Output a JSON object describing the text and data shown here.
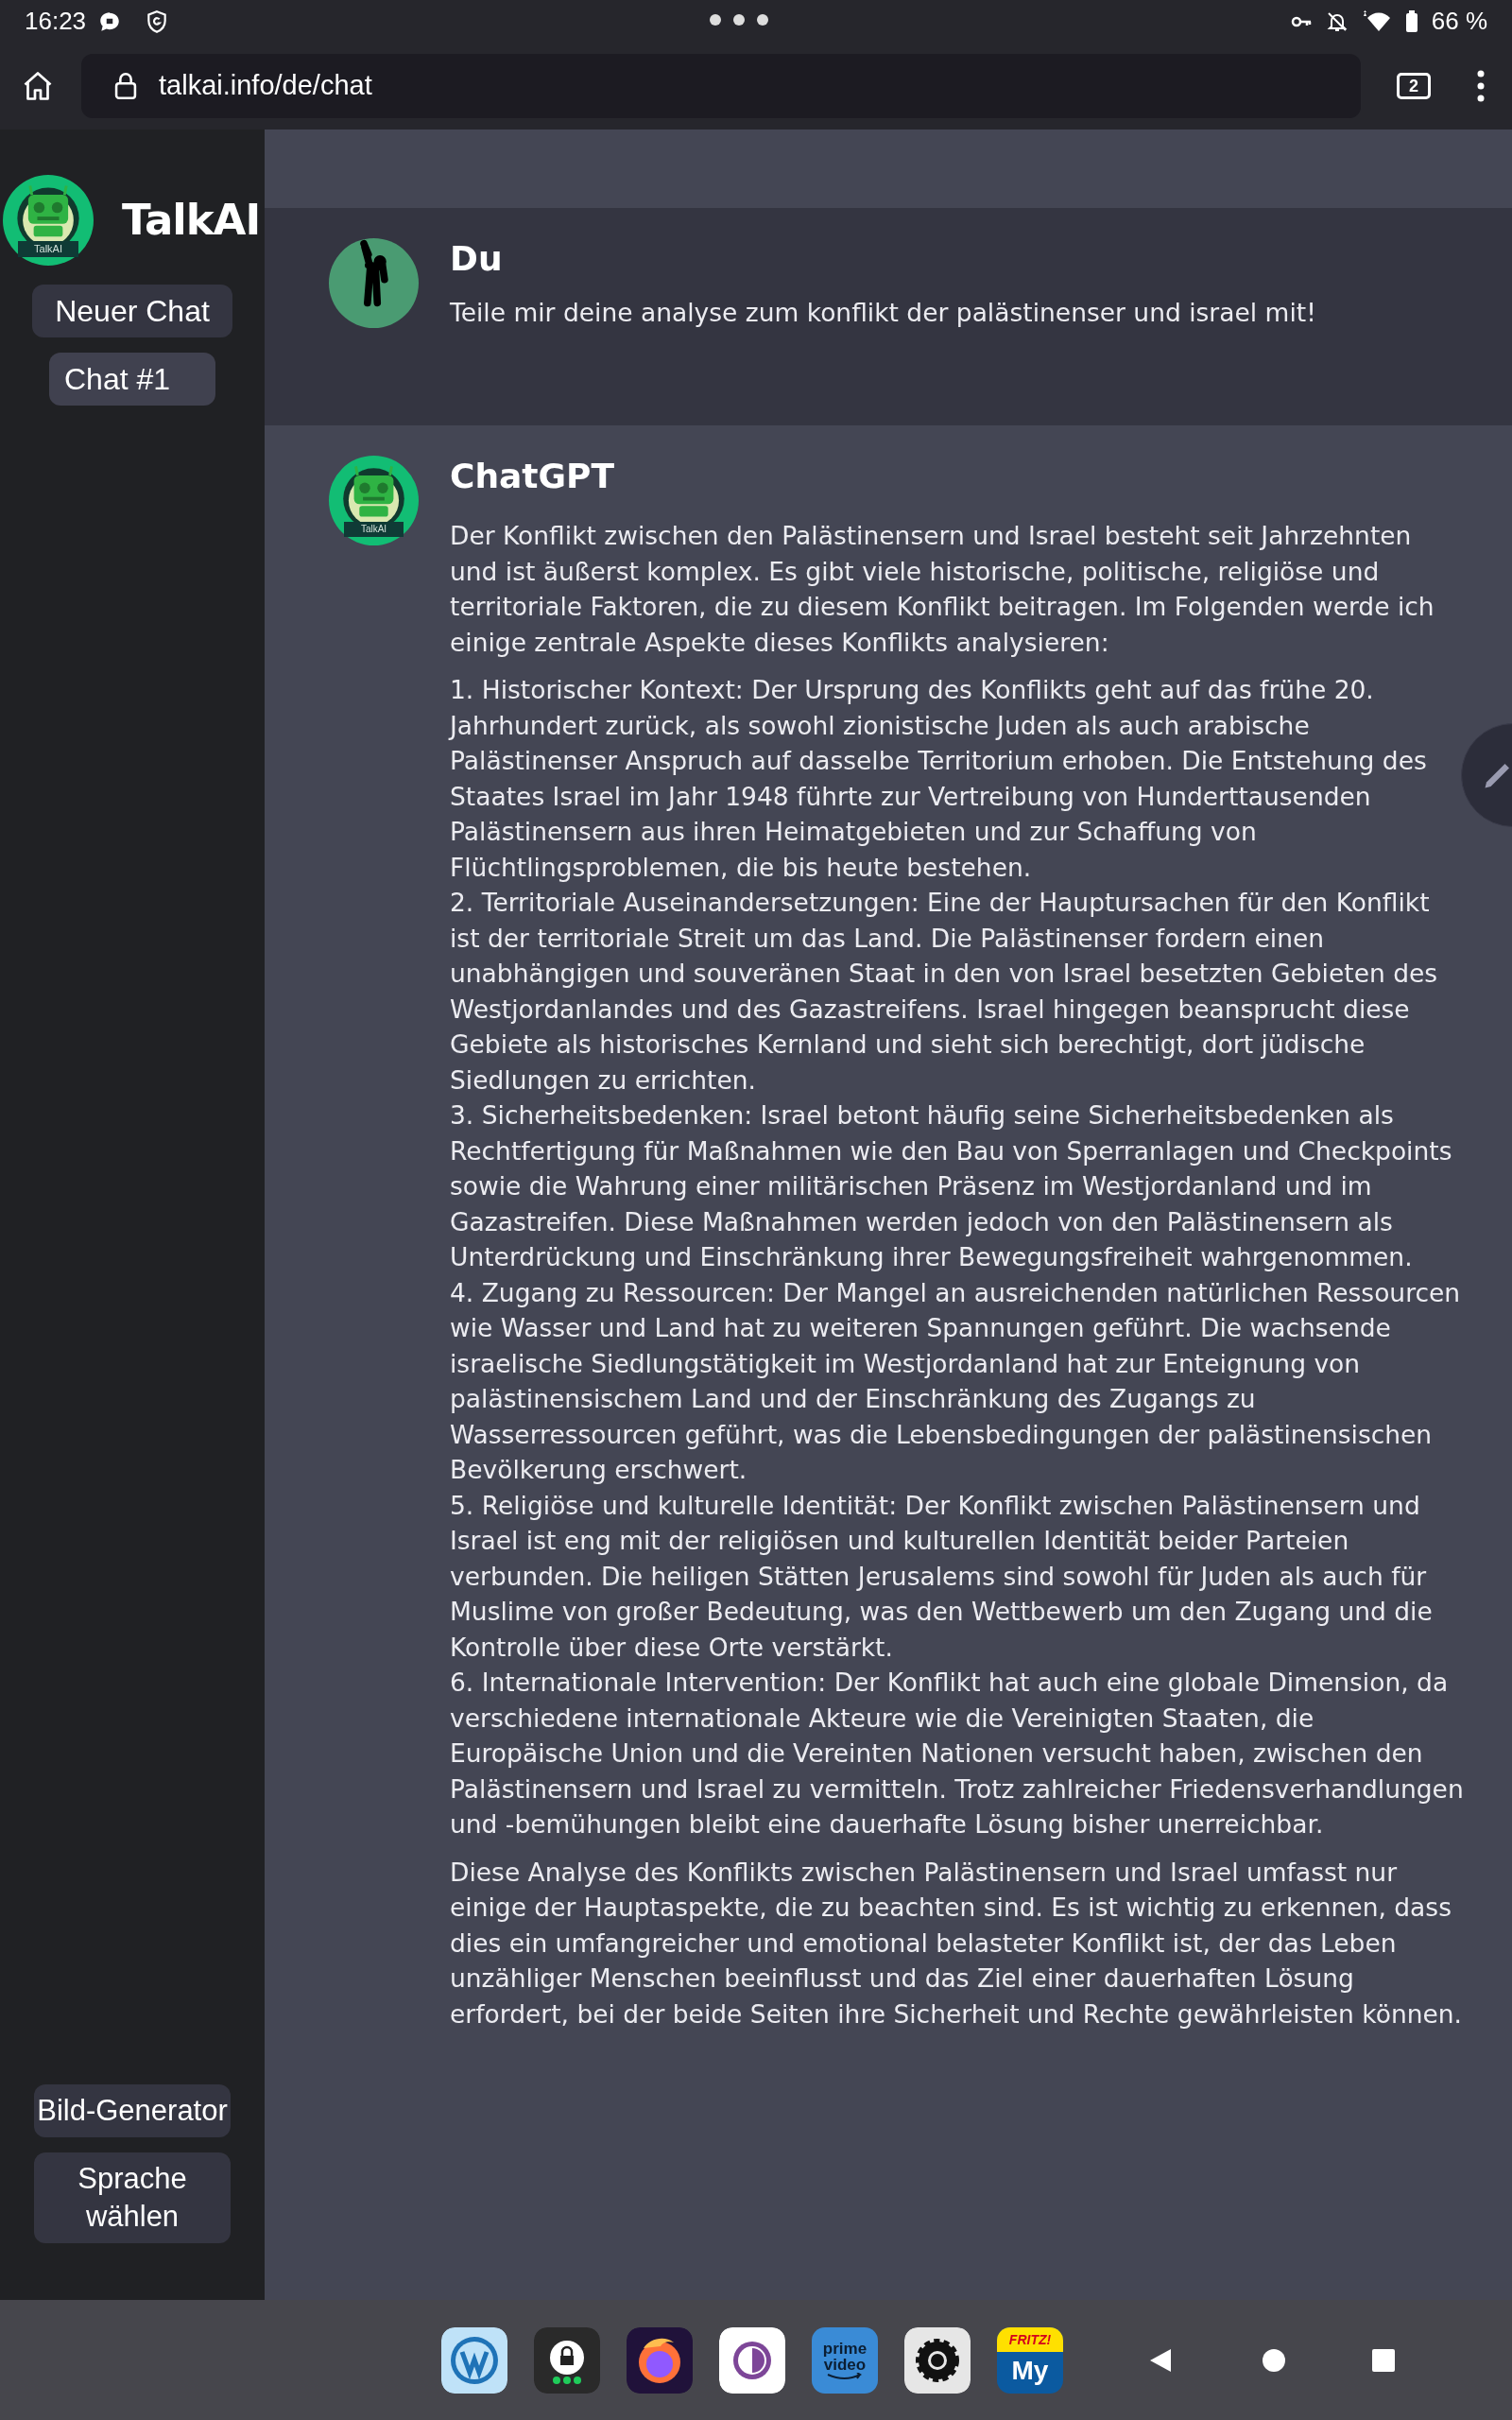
{
  "status_bar": {
    "time": "16:23",
    "battery": "66 %"
  },
  "browser": {
    "url": "talkai.info/de/chat",
    "tab_count": "2"
  },
  "sidebar": {
    "brand": "TalkAI",
    "logo_badge": "TalkAI",
    "top_buttons": [
      {
        "label": "Neuer Chat",
        "selected": false
      },
      {
        "label": "Chat #1",
        "selected": true
      }
    ],
    "bottom_buttons": [
      "Bild-Generator",
      "Sprache wählen"
    ]
  },
  "messages": [
    {
      "kind": "user",
      "author": "Du",
      "blocks": [
        {
          "kind": "paragraph",
          "text": "Teile mir deine analyse zum konflikt der palästinenser und israel mit!"
        }
      ]
    },
    {
      "kind": "assistant",
      "author": "ChatGPT",
      "avatar_badge": "TalkAI",
      "blocks": [
        {
          "kind": "paragraph",
          "text": "Der Konflikt zwischen den Palästinensern und Israel besteht seit Jahrzehnten und ist äußerst komplex. Es gibt viele historische, politische, religiöse und territoriale Faktoren, die zu diesem Konflikt beitragen. Im Folgenden werde ich einige zentrale Aspekte dieses Konflikts analysieren:"
        },
        {
          "kind": "list",
          "items": [
            "1. Historischer Kontext: Der Ursprung des Konflikts geht auf das frühe 20. Jahrhundert zurück, als sowohl zionistische Juden als auch arabische Palästinenser Anspruch auf dasselbe Territorium erhoben. Die Entstehung des Staates Israel im Jahr 1948 führte zur Vertreibung von Hunderttausenden Palästinensern aus ihren Heimatgebieten und zur Schaffung von Flüchtlingsproblemen, die bis heute bestehen.",
            "2. Territoriale Auseinandersetzungen: Eine der Hauptursachen für den Konflikt ist der territoriale Streit um das Land. Die Palästinenser fordern einen unabhängigen und souveränen Staat in den von Israel besetzten Gebieten des Westjordanlandes und des Gazastreifens. Israel hingegen beansprucht diese Gebiete als historisches Kernland und sieht sich berechtigt, dort jüdische Siedlungen zu errichten.",
            "3. Sicherheitsbedenken: Israel betont häufig seine Sicherheitsbedenken als Rechtfertigung für Maßnahmen wie den Bau von Sperranlagen und Checkpoints sowie die Wahrung einer militärischen Präsenz im Westjordanland und im Gazastreifen. Diese Maßnahmen werden jedoch von den Palästinensern als Unterdrückung und Einschränkung ihrer Bewegungsfreiheit wahrgenommen.",
            "4. Zugang zu Ressourcen: Der Mangel an ausreichenden natürlichen Ressourcen wie Wasser und Land hat zu weiteren Spannungen geführt. Die wachsende israelische Siedlungstätigkeit im Westjordanland hat zur Enteignung von palästinensischem Land und der Einschränkung des Zugangs zu Wasserressourcen geführt, was die Lebensbedingungen der palästinensischen Bevölkerung erschwert.",
            "5. Religiöse und kulturelle Identität: Der Konflikt zwischen Palästinensern und Israel ist eng mit der religiösen und kulturellen Identität beider Parteien verbunden. Die heiligen Stätten Jerusalems sind sowohl für Juden als auch für Muslime von großer Bedeutung, was den Wettbewerb um den Zugang und die Kontrolle über diese Orte verstärkt.",
            "6. Internationale Intervention: Der Konflikt hat auch eine globale Dimension, da verschiedene internationale Akteure wie die Vereinigten Staaten, die Europäische Union und die Vereinten Nationen versucht haben, zwischen den Palästinensern und Israel zu vermitteln. Trotz zahlreicher Friedensverhandlungen und -bemühungen bleibt eine dauerhafte Lösung bisher unerreichbar."
          ]
        },
        {
          "kind": "paragraph",
          "text": "Diese Analyse des Konflikts zwischen Palästinensern und Israel umfasst nur einige der Hauptaspekte, die zu beachten sind. Es ist wichtig zu erkennen, dass dies ein umfangreicher und emotional belasteter Konflikt ist, der das Leben unzähliger Menschen beeinflusst und das Ziel einer dauerhaften Lösung erfordert, bei der beide Seiten ihre Sicherheit und Rechte gewährleisten können."
        }
      ]
    }
  ],
  "dock": {
    "apps": [
      {
        "kind": "wordpress"
      },
      {
        "kind": "lock-chat"
      },
      {
        "kind": "firefox"
      },
      {
        "kind": "tor"
      },
      {
        "kind": "prime",
        "lines": [
          "prime",
          "video"
        ]
      },
      {
        "kind": "gear"
      },
      {
        "kind": "fritz",
        "lines": [
          "FRITZ!",
          "My"
        ]
      }
    ]
  }
}
